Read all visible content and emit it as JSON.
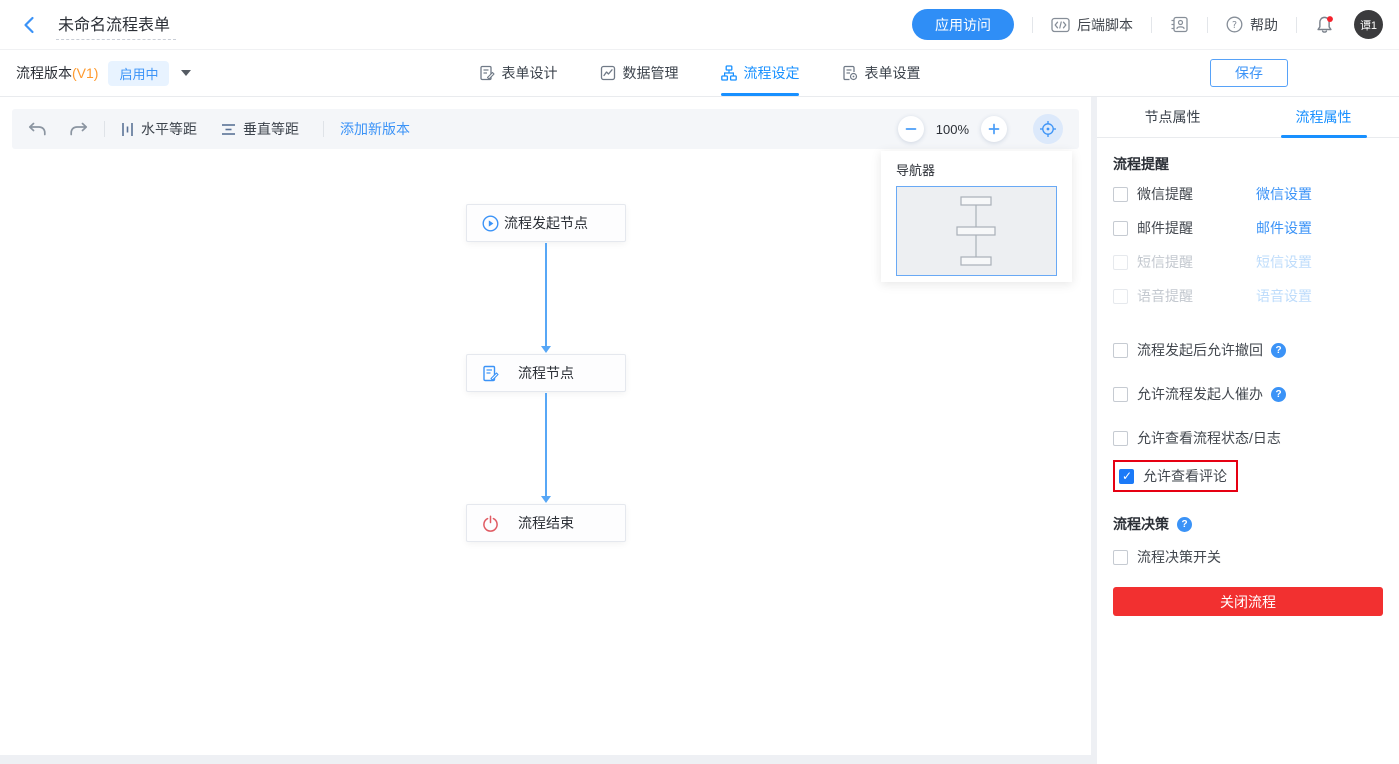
{
  "colors": {
    "accent": "#1890ff",
    "primary_button": "#2f8ef6",
    "danger_button": "#f23030",
    "highlight_box": "#e60012",
    "version_orange": "#ff9a2e",
    "status_badge_bg": "#e8f3ff",
    "link_blue": "#3b93f7",
    "disabled_link": "#bedcfb",
    "edge_blue": "#57a7f6"
  },
  "header": {
    "title": "未命名流程表单",
    "app_access": "应用访问",
    "backend_script": "后端脚本",
    "help": "帮助",
    "avatar": "谭1"
  },
  "version_bar": {
    "label": "流程版本",
    "version": "(V1)",
    "status": "启用中",
    "save": "保存",
    "tabs": [
      {
        "label": "表单设计",
        "active": false
      },
      {
        "label": "数据管理",
        "active": false
      },
      {
        "label": "流程设定",
        "active": true
      },
      {
        "label": "表单设置",
        "active": false
      }
    ]
  },
  "canvas": {
    "toolbar": {
      "horizontal_equal": "水平等距",
      "vertical_equal": "垂直等距",
      "add_new_version": "添加新版本",
      "zoom_level": "100%"
    },
    "navigator": {
      "title": "导航器"
    },
    "nodes": [
      {
        "label": "流程发起节点",
        "icon": "play-circle-icon"
      },
      {
        "label": "流程节点",
        "icon": "form-edit-icon"
      },
      {
        "label": "流程结束",
        "icon": "power-icon"
      }
    ]
  },
  "panel": {
    "tabs": [
      {
        "label": "节点属性",
        "active": false
      },
      {
        "label": "流程属性",
        "active": true
      }
    ],
    "reminder": {
      "title": "流程提醒",
      "rows": [
        {
          "label": "微信提醒",
          "link": "微信设置",
          "checked": false,
          "disabled": false
        },
        {
          "label": "邮件提醒",
          "link": "邮件设置",
          "checked": false,
          "disabled": false
        },
        {
          "label": "短信提醒",
          "link": "短信设置",
          "checked": false,
          "disabled": true
        },
        {
          "label": "语音提醒",
          "link": "语音设置",
          "checked": false,
          "disabled": true
        }
      ]
    },
    "options": [
      {
        "label": "流程发起后允许撤回",
        "checked": false,
        "help": true
      },
      {
        "label": "允许流程发起人催办",
        "checked": false,
        "help": true
      },
      {
        "label": "允许查看流程状态/日志",
        "checked": false,
        "help": false
      },
      {
        "label": "允许查看评论",
        "checked": true,
        "help": false,
        "highlighted": true
      }
    ],
    "decision": {
      "title": "流程决策",
      "switch_label": "流程决策开关",
      "checked": false
    },
    "close_button": "关闭流程"
  }
}
